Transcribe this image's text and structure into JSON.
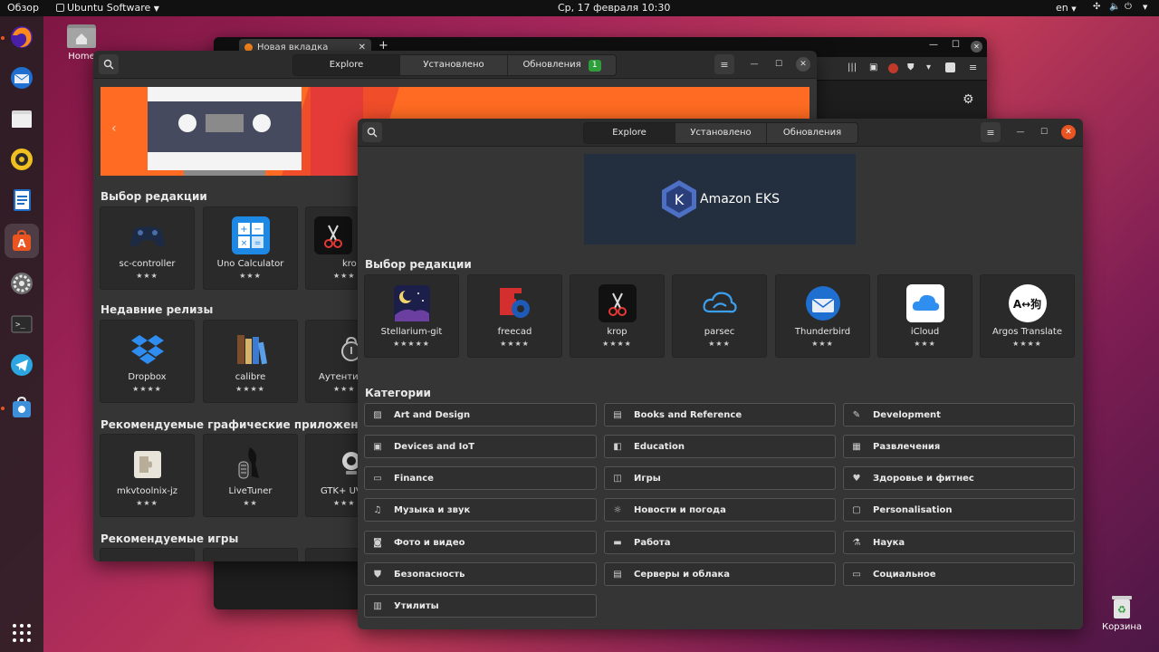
{
  "topbar": {
    "activities": "Обзор",
    "app_menu": "Ubuntu Software",
    "clock": "Ср, 17 февраля  10:30",
    "lang": "en"
  },
  "desktop": {
    "home_label": "Home",
    "trash_label": "Корзина"
  },
  "browser": {
    "tab_title": "Новая вкладка"
  },
  "back_window": {
    "tabs": [
      "Explore",
      "Установлено",
      "Обновления"
    ],
    "updates_badge": "1",
    "sections": [
      {
        "title": "Выбор редакции",
        "apps": [
          {
            "name": "sc-controller",
            "stars": "★★★"
          },
          {
            "name": "Uno Calculator",
            "stars": "★★★"
          },
          {
            "name": "kro",
            "stars": "★★★"
          }
        ]
      },
      {
        "title": "Недавние релизы",
        "apps": [
          {
            "name": "Dropbox",
            "stars": "★★★★"
          },
          {
            "name": "calibre",
            "stars": "★★★★"
          },
          {
            "name": "Аутентис",
            "stars": "★★★"
          }
        ]
      },
      {
        "title": "Рекомендуемые графические приложения",
        "apps": [
          {
            "name": "mkvtoolnix-jz",
            "stars": "★★★"
          },
          {
            "name": "LiveTuner",
            "stars": "★★"
          },
          {
            "name": "GTK+ UVC",
            "stars": "★★★"
          }
        ]
      },
      {
        "title": "Рекомендуемые игры",
        "apps": []
      }
    ]
  },
  "front_window": {
    "tabs": [
      "Explore",
      "Установлено",
      "Обновления"
    ],
    "banner_text": "Amazon EKS",
    "banner_logo_letter": "K",
    "editors_title": "Выбор редакции",
    "apps": [
      {
        "name": "Stellarium-git",
        "stars": "★★★★★"
      },
      {
        "name": "freecad",
        "stars": "★★★★"
      },
      {
        "name": "krop",
        "stars": "★★★★"
      },
      {
        "name": "parsec",
        "stars": "★★★"
      },
      {
        "name": "Thunderbird",
        "stars": "★★★"
      },
      {
        "name": "iCloud",
        "stars": "★★★"
      },
      {
        "name": "Argos Translate",
        "stars": "★★★★"
      }
    ],
    "argos_icon_text": "A↔狗",
    "categories_title": "Категории",
    "categories": [
      "Art and Design",
      "Books and Reference",
      "Development",
      "Devices and IoT",
      "Education",
      "Развлечения",
      "Finance",
      "Игры",
      "Здоровье и фитнес",
      "Музыка и звук",
      "Новости и погода",
      "Personalisation",
      "Фото и видео",
      "Работа",
      "Наука",
      "Безопасность",
      "Серверы и облака",
      "Социальное",
      "Утилиты"
    ]
  },
  "colors": {
    "accent": "#e95420",
    "badge": "#2e9e3a",
    "close": "#e95420"
  }
}
